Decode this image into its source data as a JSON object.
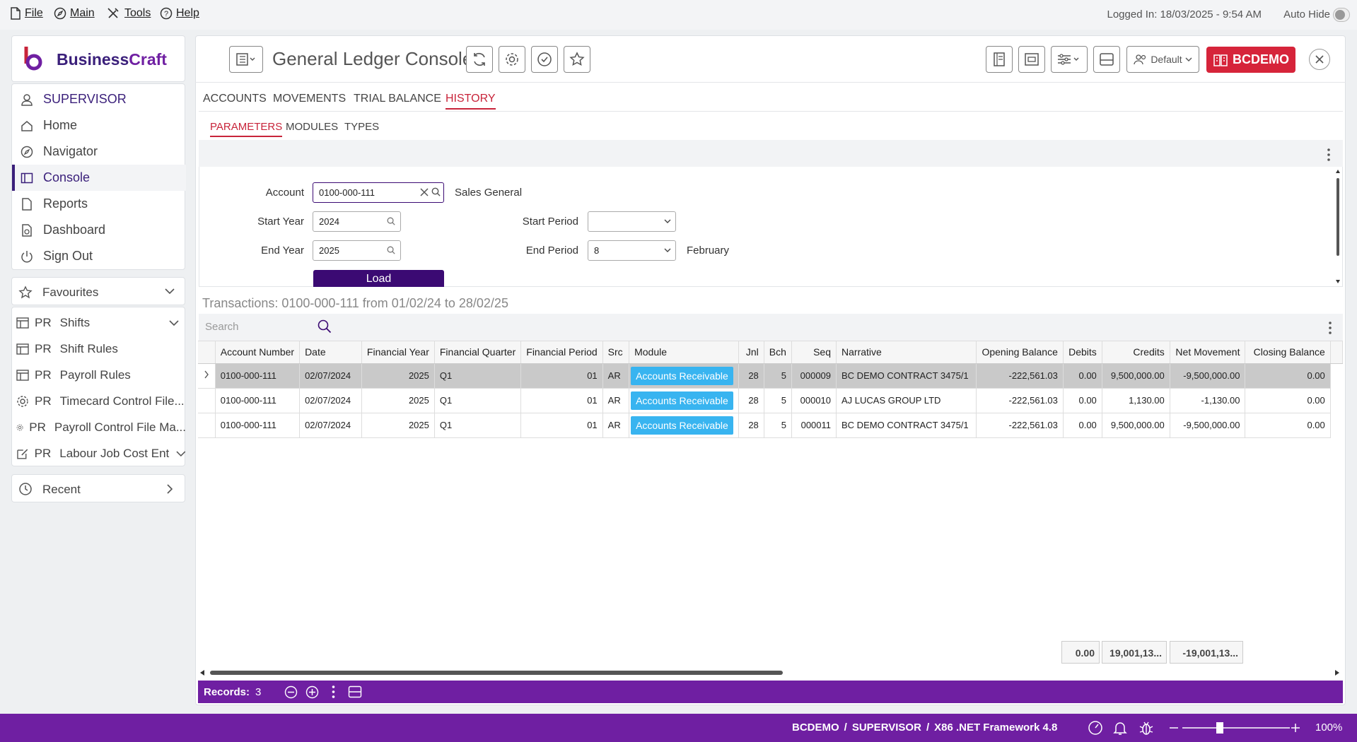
{
  "menu": {
    "file": "File",
    "main": "Main",
    "tools": "Tools",
    "help": "Help"
  },
  "header": {
    "logged_in": "Logged In: 18/03/2025 - 9:54 AM",
    "auto_hide": "Auto Hide"
  },
  "brand": {
    "name_part1": "Business",
    "name_part2": "Craft"
  },
  "sidebar": {
    "user": "SUPERVISOR",
    "items": [
      {
        "label": "Home",
        "icon": "home-icon"
      },
      {
        "label": "Navigator",
        "icon": "compass-icon"
      },
      {
        "label": "Console",
        "icon": "console-icon"
      },
      {
        "label": "Reports",
        "icon": "report-icon"
      },
      {
        "label": "Dashboard",
        "icon": "dashboard-icon"
      },
      {
        "label": "Sign Out",
        "icon": "power-icon"
      }
    ],
    "favourites": "Favourites",
    "fav_items": [
      {
        "prefix": "PR",
        "label": "Shifts"
      },
      {
        "prefix": "PR",
        "label": "Shift Rules"
      },
      {
        "prefix": "PR",
        "label": "Payroll Rules"
      },
      {
        "prefix": "PR",
        "label": "Timecard Control File..."
      },
      {
        "prefix": "PR",
        "label": "Payroll Control File Ma..."
      },
      {
        "prefix": "PR",
        "label": "Labour Job Cost Ent"
      }
    ],
    "recent": "Recent"
  },
  "console": {
    "title": "General Ledger Console",
    "profile": "Default",
    "company": "BCDEMO",
    "tabs": [
      "ACCOUNTS",
      "MOVEMENTS",
      "TRIAL BALANCE",
      "HISTORY"
    ],
    "subtabs": [
      "PARAMETERS",
      "MODULES",
      "TYPES"
    ]
  },
  "params": {
    "account_label": "Account",
    "account_value": "0100-000-111",
    "account_desc": "Sales General",
    "start_year_label": "Start Year",
    "start_year": "2024",
    "end_year_label": "End Year",
    "end_year": "2025",
    "start_period_label": "Start Period",
    "start_period": "",
    "end_period_label": "End Period",
    "end_period": "8",
    "end_period_desc": "February",
    "load": "Load"
  },
  "transactions": {
    "title": "Transactions: 0100-000-111 from 01/02/24 to 28/02/25",
    "search_placeholder": "Search",
    "columns": [
      "Account Number",
      "Date",
      "Financial Year",
      "Financial Quarter",
      "Financial Period",
      "Src",
      "Module",
      "Jnl",
      "Bch",
      "Seq",
      "Narrative",
      "Opening Balance",
      "Debits",
      "Credits",
      "Net Movement",
      "Closing Balance"
    ],
    "rows": [
      [
        "0100-000-111",
        "02/07/2024",
        "2025",
        "Q1",
        "01",
        "AR",
        "Accounts Receivable",
        "28",
        "5",
        "000009",
        "BC DEMO CONTRACT 3475/1",
        "-222,561.03",
        "0.00",
        "9,500,000.00",
        "-9,500,000.00",
        "0.00"
      ],
      [
        "0100-000-111",
        "02/07/2024",
        "2025",
        "Q1",
        "01",
        "AR",
        "Accounts Receivable",
        "28",
        "5",
        "000010",
        "AJ LUCAS GROUP LTD",
        "-222,561.03",
        "0.00",
        "1,130.00",
        "-1,130.00",
        "0.00"
      ],
      [
        "0100-000-111",
        "02/07/2024",
        "2025",
        "Q1",
        "01",
        "AR",
        "Accounts Receivable",
        "28",
        "5",
        "000011",
        "BC DEMO CONTRACT 3475/1",
        "-222,561.03",
        "0.00",
        "9,500,000.00",
        "-9,500,000.00",
        "0.00"
      ]
    ],
    "totals": {
      "debits": "0.00",
      "credits": "19,001,13...",
      "net": "-19,001,13..."
    },
    "records_label": "Records:",
    "records": "3"
  },
  "footer": {
    "company": "BCDEMO",
    "user": "SUPERVISOR",
    "framework": "X86 .NET Framework 4.8",
    "zoom": "100%"
  },
  "colors": {
    "brand_purple": "#6f1fa2",
    "active_tab": "#c8243a",
    "company_badge": "#d6243a",
    "module_badge": "#38b4f0"
  }
}
